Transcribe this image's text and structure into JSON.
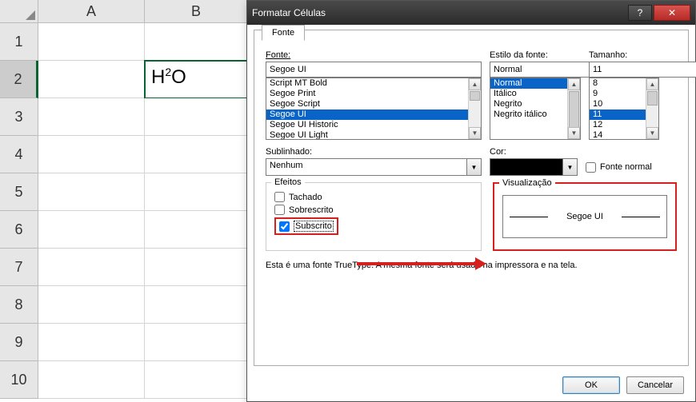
{
  "sheet": {
    "columns": [
      "A",
      "B"
    ],
    "rows": [
      "1",
      "2",
      "3",
      "4",
      "5",
      "6",
      "7",
      "8",
      "9",
      "10"
    ],
    "selected_row": 2,
    "cell_b2_base": "H",
    "cell_b2_sup": "2",
    "cell_b2_tail": "O"
  },
  "dialog": {
    "title": "Formatar Células",
    "tab": "Fonte",
    "font": {
      "label": "Fonte:",
      "value": "Segoe UI",
      "options": [
        "Script MT Bold",
        "Segoe Print",
        "Segoe Script",
        "Segoe UI",
        "Segoe UI Historic",
        "Segoe UI Light"
      ],
      "selected": "Segoe UI"
    },
    "style": {
      "label": "Estilo da fonte:",
      "value": "Normal",
      "options": [
        "Normal",
        "Itálico",
        "Negrito",
        "Negrito itálico"
      ],
      "selected": "Normal"
    },
    "size": {
      "label": "Tamanho:",
      "value": "11",
      "options": [
        "8",
        "9",
        "10",
        "11",
        "12",
        "14"
      ],
      "selected": "11"
    },
    "underline": {
      "label": "Sublinhado:",
      "value": "Nenhum"
    },
    "color": {
      "label": "Cor:",
      "value": "#000000"
    },
    "normal_font": {
      "label": "Fonte normal",
      "checked": false
    },
    "effects": {
      "legend": "Efeitos",
      "strike": {
        "label": "Tachado",
        "checked": false
      },
      "superscript": {
        "label": "Sobrescrito",
        "checked": false
      },
      "subscript": {
        "label": "Subscrito",
        "checked": true
      }
    },
    "preview": {
      "legend": "Visualização",
      "text": "Segoe UI"
    },
    "info": "Esta é uma fonte TrueType. A mesma fonte será usada na impressora e na tela.",
    "ok": "OK",
    "cancel": "Cancelar"
  }
}
